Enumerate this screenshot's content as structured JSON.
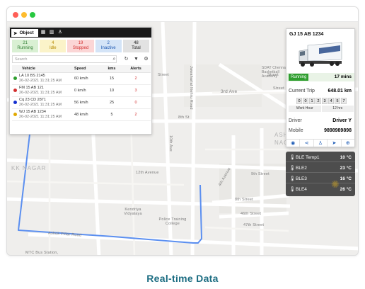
{
  "window": {
    "dot_colors": [
      "#ff5f57",
      "#febc2e",
      "#28c840"
    ]
  },
  "map": {
    "labels": {
      "street1": "Street",
      "third_ave": "3rd Ave",
      "jawaharlal": "Jawaharlal Nehru Road",
      "eighth_st": "8th St",
      "tenth_ave": "10th Ave",
      "sdat": "SDAT Chennai Basketball Academy",
      "street_r1": "Street",
      "street_r2": "Street",
      "ashok": "ASHO",
      "nagar_r": "NAGA",
      "kk_nagar": "KK NAGAR",
      "twelfth_ave": "12th Avenue",
      "ninth_st": "9th Street",
      "fourth_ave": "4th Avenue",
      "eighth_street": "8th Street",
      "fortysixth": "46th Street",
      "fortyseventh": "47th Street",
      "kendriya": "Kendriya Vidyalaya",
      "police": "Police Training College",
      "ashok_pillar": "Ashok Pillar Road",
      "mtc": "MTC Bus Station,"
    }
  },
  "object_panel": {
    "tab_label": "Object",
    "tab_icons": [
      "navigation-icon",
      "building-icon",
      "grid-icon",
      "person-icon"
    ],
    "stats": [
      {
        "count": "21",
        "label": "Running",
        "bg": "#d9f0d3",
        "color": "#2e7d32"
      },
      {
        "count": "4",
        "label": "Idle",
        "bg": "#fbf3c9",
        "color": "#b58900"
      },
      {
        "count": "19",
        "label": "Stopped",
        "bg": "#fbd6d6",
        "color": "#d32f2f"
      },
      {
        "count": "2",
        "label": "Inactive",
        "bg": "#d4e4f7",
        "color": "#1a56b0"
      },
      {
        "count": "48",
        "label": "Total",
        "bg": "#e2e2e2",
        "color": "#222222"
      }
    ],
    "search": {
      "placeholder": "Search"
    },
    "columns": [
      "Vehicle",
      "Speed",
      "kms",
      "Alerts"
    ],
    "rows": [
      {
        "vehicle": "LA 10 BS 2145",
        "date": "26-02-2021 11:31:25 AM",
        "speed": "60 km/h",
        "kms": "15",
        "alerts": "2",
        "status_color": "#2e9e2e"
      },
      {
        "vehicle": "FM 15 AB 121",
        "date": "26-02-2021 11:31:25 AM",
        "speed": "0 km/h",
        "kms": "10",
        "alerts": "3",
        "status_color": "#d32f2f"
      },
      {
        "vehicle": "Cq 23 CD 2871",
        "date": "26-02-2021 11:31:25 AM",
        "speed": "56 km/h",
        "kms": "25",
        "alerts": "0",
        "status_color": "#1530d0"
      },
      {
        "vehicle": "WJ 15 AB 1234",
        "date": "26-02-2021 11:31:25 AM",
        "speed": "48 km/h",
        "kms": "5",
        "alerts": "2",
        "status_color": "#e0a800"
      }
    ]
  },
  "vehicle_card": {
    "title": "GJ 15 AB 1234",
    "status": "Running",
    "status_time": "17 mins",
    "current_trip_label": "Current Trip",
    "current_trip_value": "648.01 km",
    "odometer": [
      "0",
      "0",
      "1",
      "2",
      "3",
      "4",
      "5",
      "7"
    ],
    "work_hour_label": "Work Hour",
    "work_hour_value": "12 hrs",
    "driver_label": "Driver",
    "driver_value": "Driver Y",
    "mobile_label": "Mobile",
    "mobile_value": "9898989898",
    "action_icons": [
      "eye-icon",
      "share-icon",
      "person-icon",
      "navigate-icon",
      "zoom-icon"
    ]
  },
  "sensor_panel": {
    "rows": [
      {
        "name": "BLE Temp1",
        "value": "10 °C"
      },
      {
        "name": "BLE2",
        "value": "23 °C"
      },
      {
        "name": "BLE3",
        "value": "16 °C"
      },
      {
        "name": "BLE4",
        "value": "26 °C"
      }
    ]
  },
  "caption": "Real-time Data"
}
